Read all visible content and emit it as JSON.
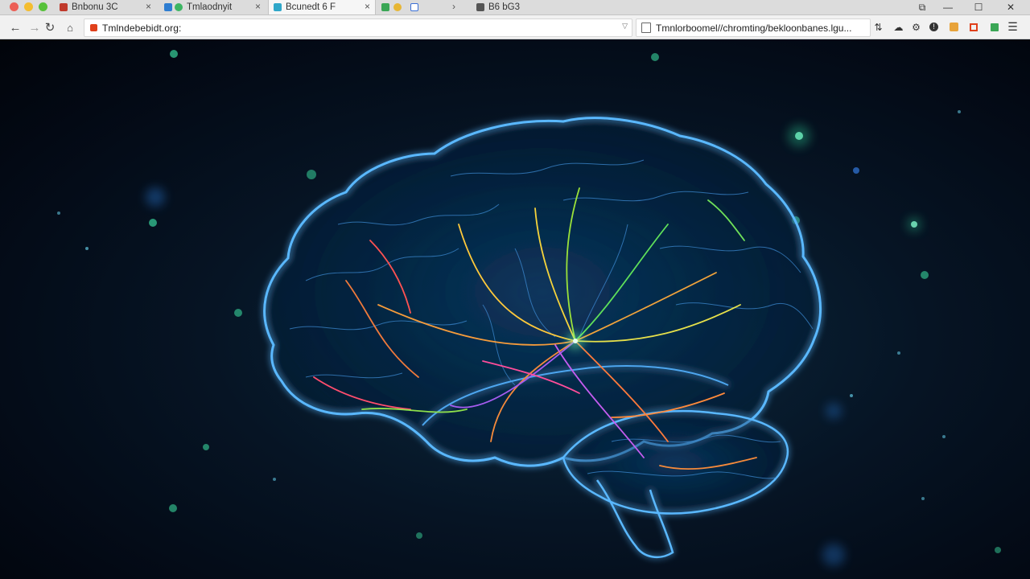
{
  "browser": {
    "tabs": [
      {
        "label": "Bnbonu   3C",
        "favicon": "#c0392b",
        "active": false
      },
      {
        "label": "Tmlaodnyit",
        "favicon": "#2e7dd1",
        "active": false
      },
      {
        "label": "Bcunedt 6  F",
        "favicon": "#2fa7c9",
        "active": true
      },
      {
        "label": "",
        "favicon": "#3aa655",
        "active": false
      },
      {
        "label": "B6  bG3",
        "favicon": "#555555",
        "active": false
      }
    ],
    "omnibox": {
      "url": "Tmlndebebidt.org:"
    },
    "second_box": {
      "url": "Tmnlorboomel//chromting/bekloonbanes.lgu..."
    },
    "colors": {
      "chrome": "#dcdcdc",
      "toolbar": "#f1f1f1",
      "brain_glow": "#5ab8ff"
    }
  },
  "content": {
    "image": "glowing-brain-neural-network",
    "icon": "brain-icon"
  }
}
